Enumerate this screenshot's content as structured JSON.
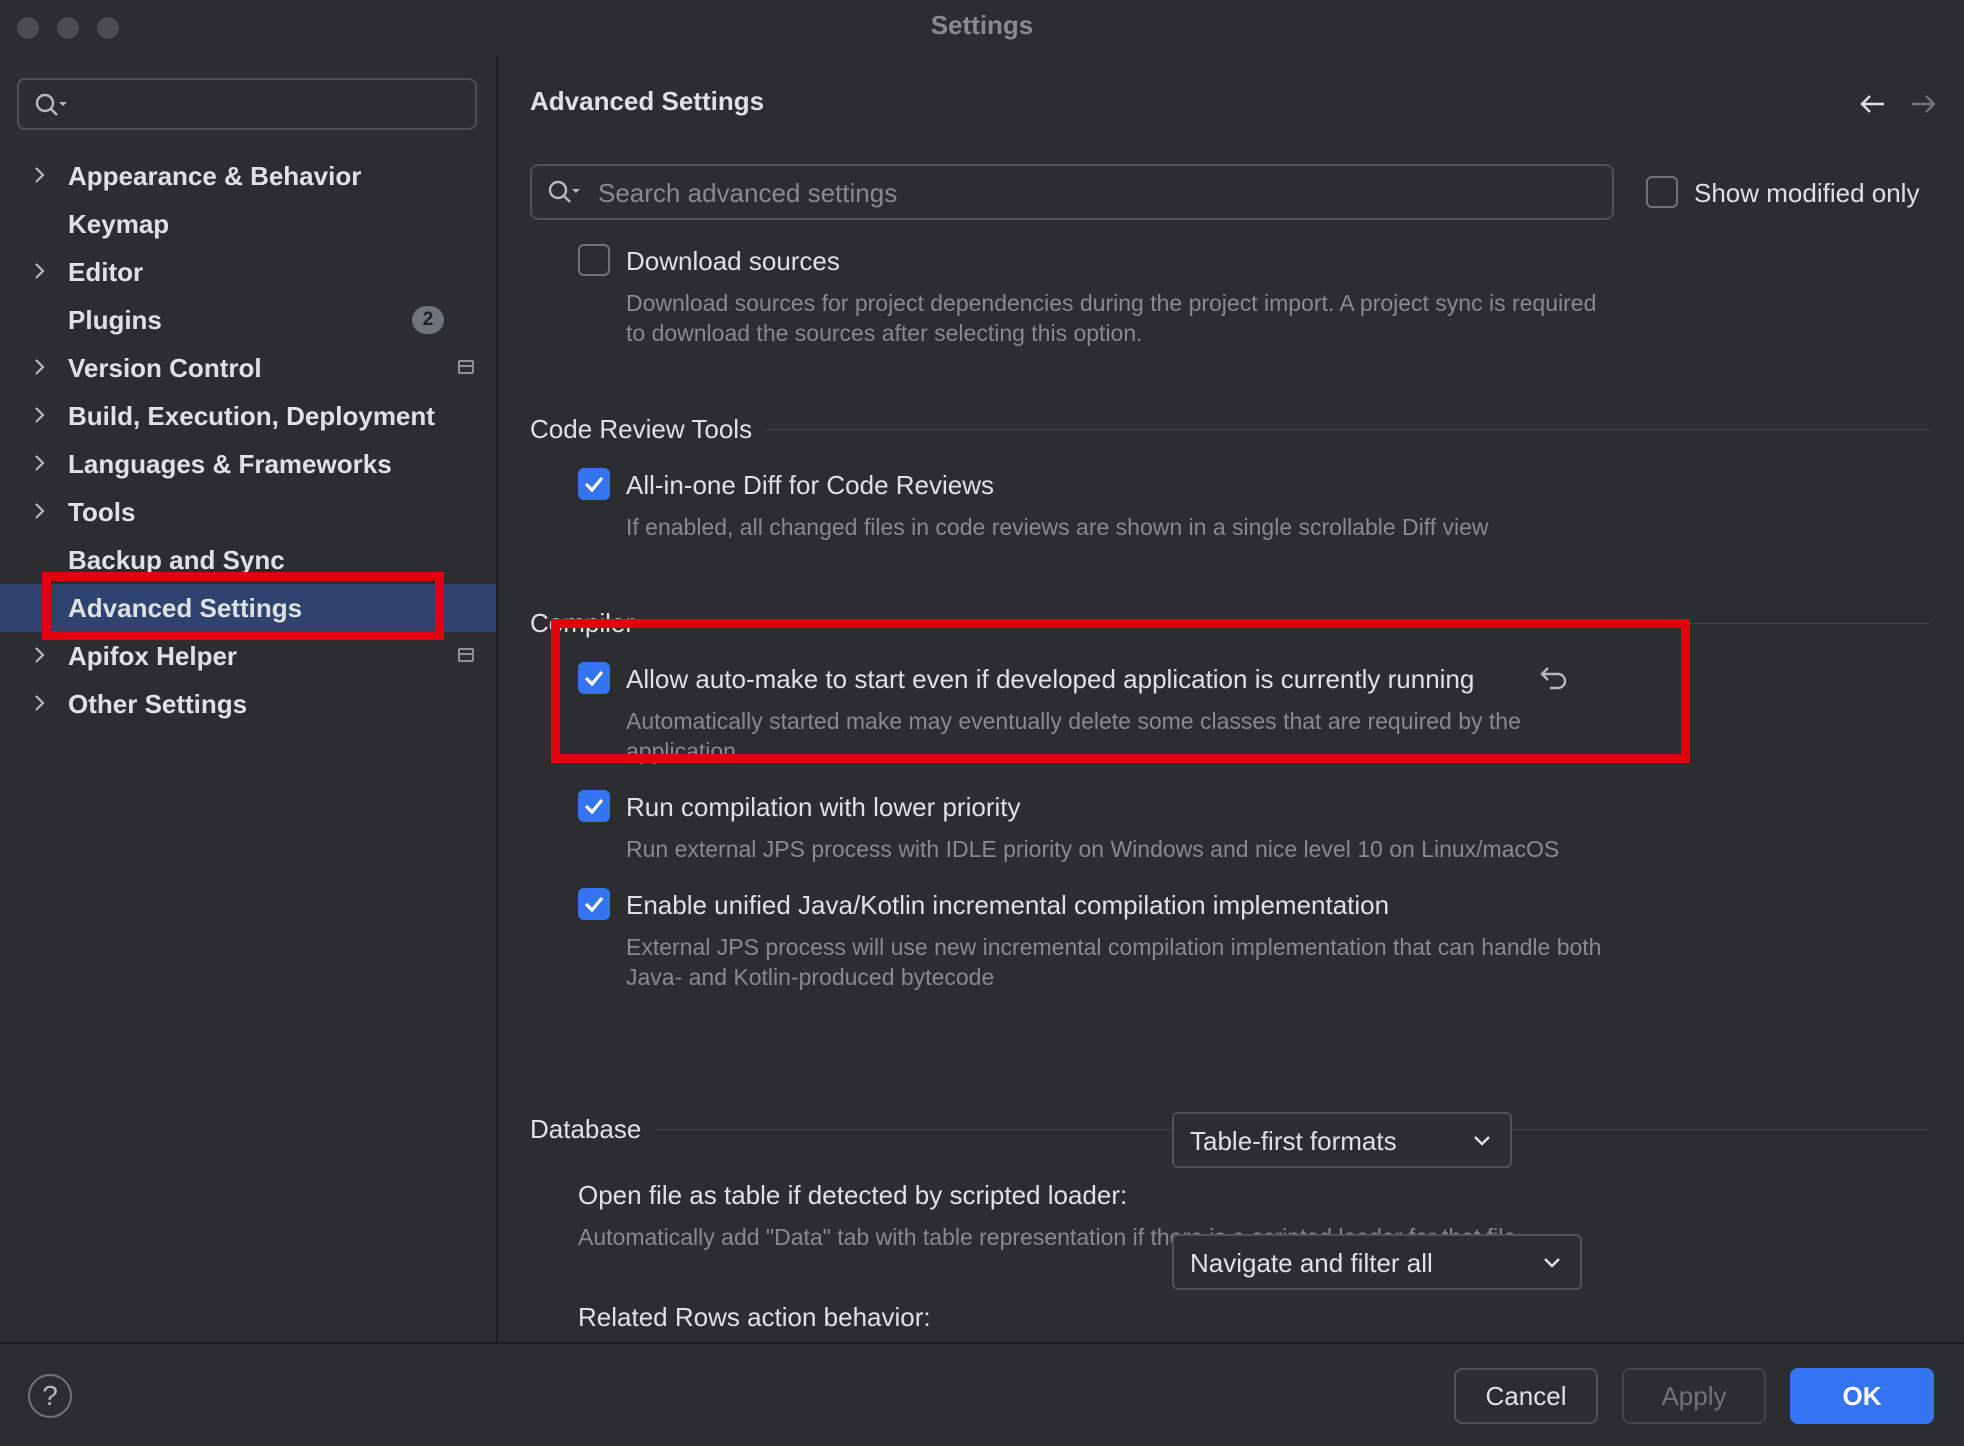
{
  "window": {
    "title": "Settings"
  },
  "sidebar": {
    "search_placeholder": "",
    "items": [
      {
        "label": "Appearance & Behavior",
        "expandable": true
      },
      {
        "label": "Keymap",
        "expandable": false
      },
      {
        "label": "Editor",
        "expandable": true
      },
      {
        "label": "Plugins",
        "expandable": false,
        "badge": "2"
      },
      {
        "label": "Version Control",
        "expandable": true,
        "icon": "project-settings-icon"
      },
      {
        "label": "Build, Execution, Deployment",
        "expandable": true
      },
      {
        "label": "Languages & Frameworks",
        "expandable": true
      },
      {
        "label": "Tools",
        "expandable": true
      },
      {
        "label": "Backup and Sync",
        "expandable": false
      },
      {
        "label": "Advanced Settings",
        "expandable": false,
        "selected": true
      },
      {
        "label": "Apifox Helper",
        "expandable": true,
        "icon": "project-settings-icon"
      },
      {
        "label": "Other Settings",
        "expandable": true
      }
    ]
  },
  "main": {
    "title": "Advanced Settings",
    "search_placeholder": "Search advanced settings",
    "show_modified_label": "Show modified only",
    "download_sources": {
      "label": "Download sources",
      "desc_line1": "Download sources for project dependencies during the project import. A project sync is required",
      "desc_line2": "to download the sources after selecting this option."
    },
    "sections": {
      "code_review": "Code Review Tools",
      "compiler": "Compiler",
      "database": "Database"
    },
    "all_in_one_diff": {
      "label": "All-in-one Diff for Code Reviews",
      "desc": "If enabled, all changed files in code reviews are shown in a single scrollable Diff view"
    },
    "auto_make": {
      "label": "Allow auto-make to start even if developed application is currently running",
      "desc_line1": "Automatically started make may eventually delete some classes that are required by the",
      "desc_line2": "application"
    },
    "low_priority": {
      "label": "Run compilation with lower priority",
      "desc": "Run external JPS process with IDLE priority on Windows and nice level 10 on Linux/macOS"
    },
    "unified_incremental": {
      "label": "Enable unified Java/Kotlin incremental compilation implementation",
      "desc_line1": "External JPS process will use new incremental compilation implementation that can handle both",
      "desc_line2": "Java- and Kotlin-produced bytecode"
    },
    "open_as_table": {
      "label": "Open file as table if detected by scripted loader:",
      "value": "Table-first formats",
      "desc": "Automatically add \"Data\" tab with table representation if there is a scripted loader for that file"
    },
    "related_rows": {
      "label": "Related Rows action behavior:",
      "value": "Navigate and filter all"
    }
  },
  "footer": {
    "help": "?",
    "cancel": "Cancel",
    "apply": "Apply",
    "ok": "OK"
  },
  "colors": {
    "background": "#2b2d30",
    "selection": "#2e436e",
    "accent": "#3574f0",
    "highlight_box": "#e0000e"
  }
}
